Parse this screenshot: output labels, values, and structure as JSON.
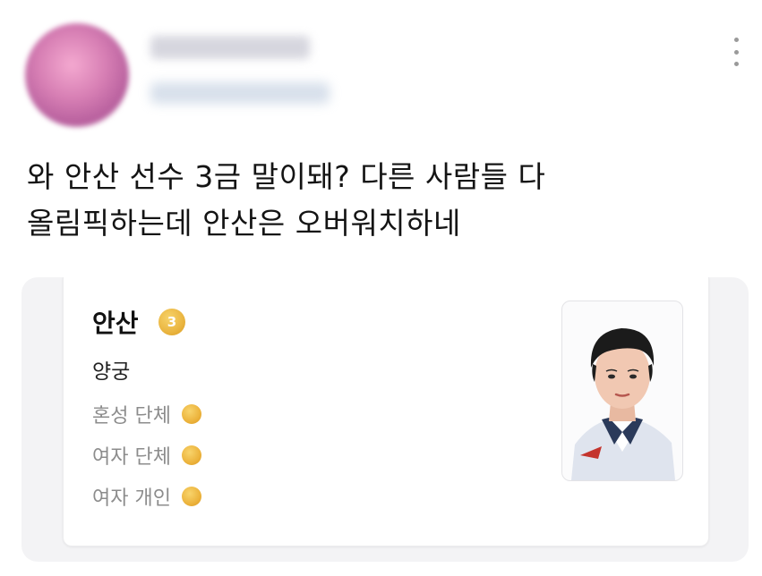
{
  "post": {
    "text_lines": [
      "와 안산 선수 3금 말이돼? 다른 사람들 다",
      "올림픽하는데 안산은 오버워치하네"
    ]
  },
  "card": {
    "athlete_name": "안산",
    "medal_count": "3",
    "sport": "양궁",
    "events": [
      {
        "name": "혼성 단체",
        "medal": "gold"
      },
      {
        "name": "여자 단체",
        "medal": "gold"
      },
      {
        "name": "여자 개인",
        "medal": "gold"
      }
    ]
  },
  "icons": {
    "more": "more-vertical-icon",
    "medal": "gold-medal-icon"
  },
  "colors": {
    "gold": "#ECB33C",
    "event_text": "#8C8C8C"
  }
}
